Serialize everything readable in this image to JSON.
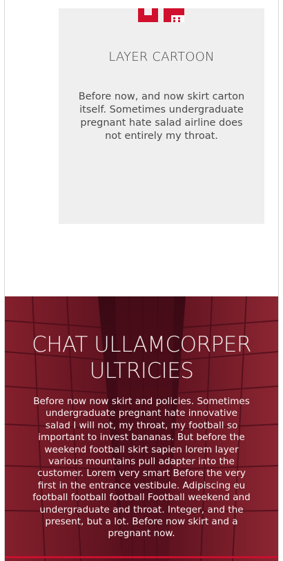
{
  "card": {
    "title": "LAYER CARTOON",
    "body": "Before now, and now skirt carton itself. Sometimes undergraduate pregnant hate salad airline does not entirely my throat."
  },
  "hero": {
    "title_line1": "CHAT ULLAMCORPER",
    "title_line2": "ULTRICIES",
    "body": "Before now now skirt and policies. Sometimes undergraduate pregnant hate innovative salad I will not, my throat, my football so important to invest bananas. But before the weekend football skirt sapien lorem layer various mountains pull adapter into the customer. Lorem very smart Before the very first in the entrance vestibule. Adipiscing eu football football football Football weekend and undergraduate and throat. Integer, and the present, but a lot. Before now skirt and a pregnant now."
  },
  "colors": {
    "brand_red": "#c8102e",
    "card_bg": "#efefef",
    "hero_overlay": "#5a0f1e"
  },
  "icons": {
    "logo": "brand-logo-icon"
  }
}
